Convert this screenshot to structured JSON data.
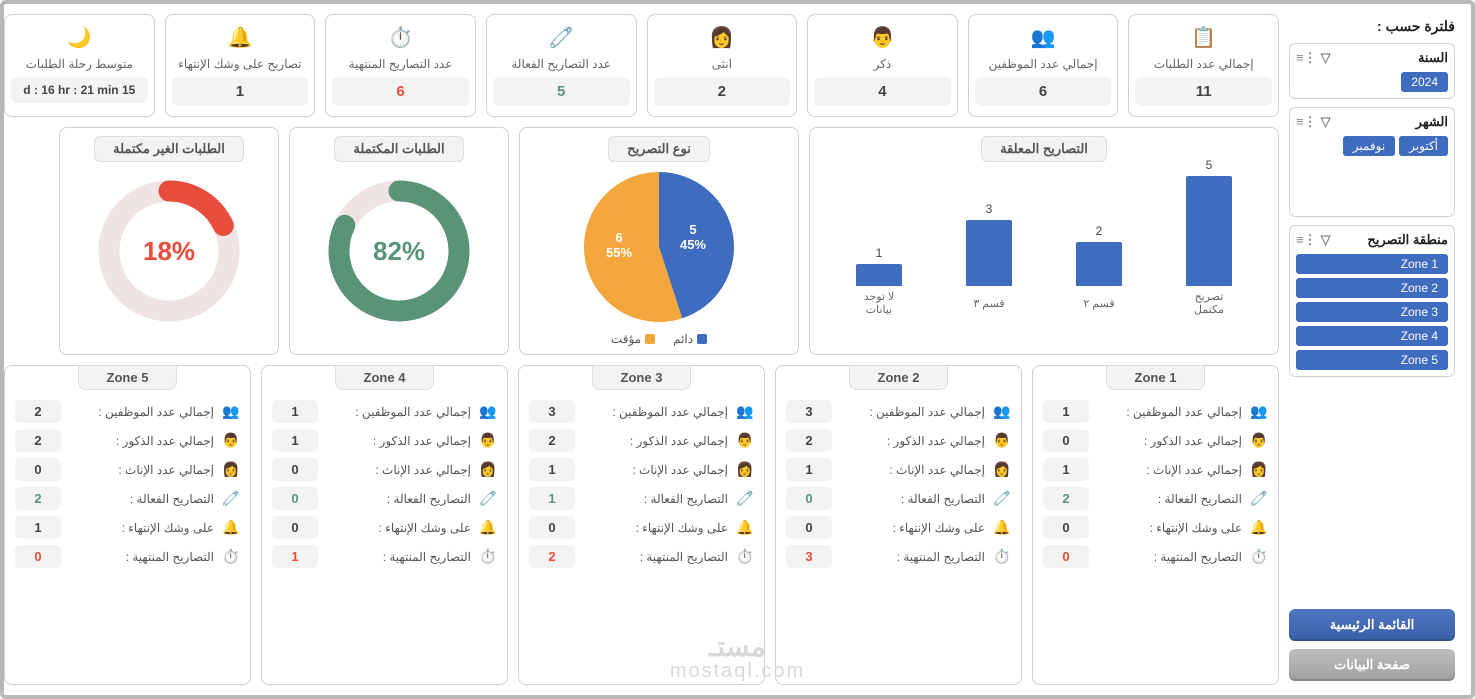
{
  "sidebar": {
    "title": "فلترة حسب :",
    "year": {
      "label": "السنة",
      "options": [
        "2024"
      ]
    },
    "month": {
      "label": "الشهر",
      "options": [
        "أكتوبر",
        "نوفمبر"
      ]
    },
    "zone": {
      "label": "منطقة التصريح",
      "options": [
        "Zone 1",
        "Zone 2",
        "Zone 3",
        "Zone 4",
        "Zone 5"
      ]
    },
    "btn_main": "القائمة الرئيسية",
    "btn_data": "صفحة البيانات"
  },
  "kpi": [
    {
      "icon": "📋",
      "label": "إجمالي عدد الطلبات",
      "value": "11",
      "cls": ""
    },
    {
      "icon": "👥",
      "label": "إجمالي عدد الموظفين",
      "value": "6",
      "cls": ""
    },
    {
      "icon": "👨",
      "label": "ذكر",
      "value": "4",
      "cls": ""
    },
    {
      "icon": "👩",
      "label": "انثى",
      "value": "2",
      "cls": ""
    },
    {
      "icon": "🧷",
      "label": "عدد التصاريح الفعالة",
      "value": "5",
      "cls": "green"
    },
    {
      "icon": "⏱️",
      "label": "عدد التصاريح المنتهية",
      "value": "6",
      "cls": "red"
    },
    {
      "icon": "🔔",
      "label": "تصاريح على وشك الإنتهاء",
      "value": "1",
      "cls": ""
    },
    {
      "icon": "🌙",
      "label": "متوسط رحلة الطلبات",
      "value": "15 d : 16 hr : 21 min",
      "cls": "",
      "wide": true
    }
  ],
  "chart_data": {
    "bar": {
      "type": "bar",
      "title": "التصاريح المعلقة",
      "categories": [
        "تصريح مكتمل",
        "قسم ٢",
        "قسم ٣",
        "لا توجد بيانات"
      ],
      "values": [
        5,
        2,
        3,
        1
      ],
      "ylim": [
        0,
        5
      ]
    },
    "pie": {
      "type": "pie",
      "title": "نوع التصريح",
      "series": [
        {
          "name": "دائم",
          "value": 5,
          "pct": 45,
          "color": "#3f6cbf"
        },
        {
          "name": "مؤقت",
          "value": 6,
          "pct": 55,
          "color": "#f2a63b"
        }
      ]
    },
    "donut_complete": {
      "type": "pie",
      "title": "الطلبات المكتملة",
      "value": 82,
      "color": "#5a9478"
    },
    "donut_incomplete": {
      "type": "pie",
      "title": "الطلبات الغير مكتملة",
      "value": 18,
      "color": "#e74c3c"
    }
  },
  "zone_labels": {
    "employees": "إجمالي عدد الموظفين :",
    "males": "إجمالي عدد الذكور :",
    "females": "إجمالي عدد الإناث :",
    "active": "التصاريح الفعالة :",
    "expiring": "على وشك الإنتهاء :",
    "expired": "التصاريح المنتهية :"
  },
  "zone_icons": {
    "employees": "👥",
    "males": "👨",
    "females": "👩",
    "active": "🧷",
    "expiring": "🔔",
    "expired": "⏱️"
  },
  "zones": [
    {
      "title": "Zone 1",
      "employees": 1,
      "males": 0,
      "females": 1,
      "active": 2,
      "expiring": 0,
      "expired": 0
    },
    {
      "title": "Zone 2",
      "employees": 3,
      "males": 2,
      "females": 1,
      "active": 0,
      "expiring": 0,
      "expired": 3
    },
    {
      "title": "Zone 3",
      "employees": 3,
      "males": 2,
      "females": 1,
      "active": 1,
      "expiring": 0,
      "expired": 2
    },
    {
      "title": "Zone 4",
      "employees": 1,
      "males": 1,
      "females": 0,
      "active": 0,
      "expiring": 0,
      "expired": 1
    },
    {
      "title": "Zone 5",
      "employees": 2,
      "males": 2,
      "females": 0,
      "active": 2,
      "expiring": 1,
      "expired": 0
    }
  ],
  "watermark": "mostaql.com"
}
